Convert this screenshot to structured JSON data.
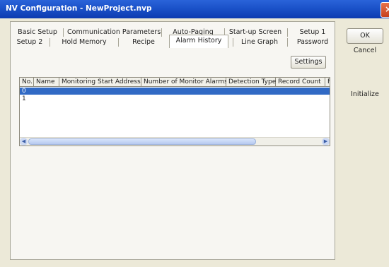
{
  "window": {
    "title": "NV Configuration - NewProject.nvp",
    "close_glyph": "×"
  },
  "tabs": {
    "row1": [
      "Basic Setup",
      "Communication Parameters",
      "Auto-Paging",
      "Start-up Screen",
      "Setup 1"
    ],
    "row2": [
      "Setup 2",
      "Hold Memory",
      "Recipe",
      "Alarm History",
      "Line Graph",
      "Password"
    ],
    "active": "Alarm History"
  },
  "panel": {
    "settings_label": "Settings"
  },
  "grid": {
    "columns": [
      "No.",
      "Name",
      "Monitoring Start Address",
      "Number of Monitor Alarms",
      "Detection Type",
      "Record Count",
      "F"
    ],
    "rows": [
      "0",
      "1"
    ],
    "selected_row": 0
  },
  "buttons": {
    "ok": "OK",
    "cancel": "Cancel",
    "initialize": "Initialize"
  },
  "colors": {
    "titlebar": "#1b52c9",
    "selection": "#316ac5"
  }
}
